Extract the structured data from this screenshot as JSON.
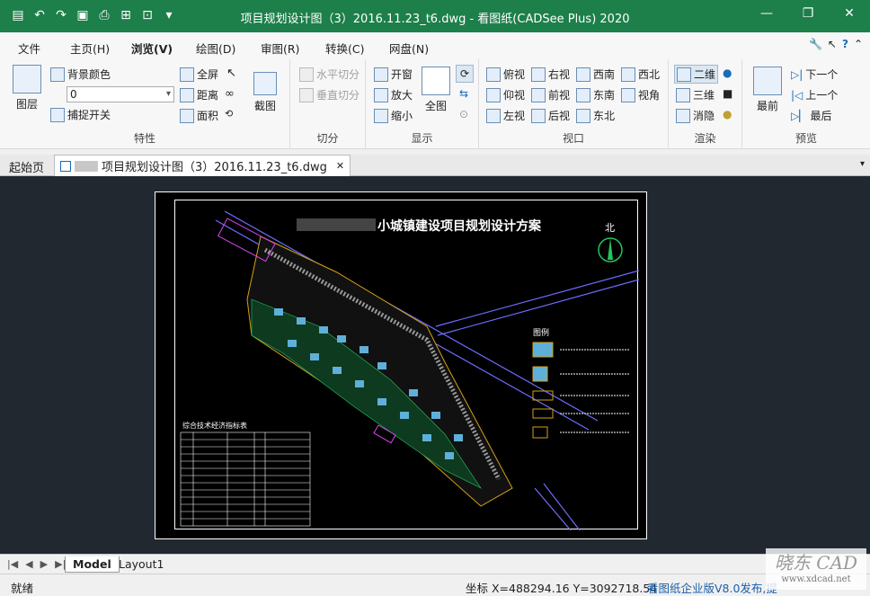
{
  "window": {
    "title": "项目规划设计图（3）2016.11.23_t6.dwg - 看图纸(CADSee Plus) 2020"
  },
  "menu": {
    "items": [
      {
        "label": "文件"
      },
      {
        "label": "主页(H)"
      },
      {
        "label": "浏览(V)"
      },
      {
        "label": "绘图(D)"
      },
      {
        "label": "审图(R)"
      },
      {
        "label": "转换(C)"
      },
      {
        "label": "网盘(N)"
      }
    ],
    "active": "浏览(V)"
  },
  "ribbon": {
    "features": {
      "label": "特性",
      "layer": "图层",
      "bg_color": "背景颜色",
      "layer_value": "0",
      "snap": "捕捉开关",
      "fullscreen": "全屏",
      "distance": "距离",
      "area": "面积",
      "screenshot": "截图"
    },
    "split": {
      "label": "切分",
      "horizontal": "水平切分",
      "vertical": "垂直切分"
    },
    "display": {
      "label": "显示",
      "open_window": "开窗",
      "zoom_in": "放大",
      "zoom_out": "缩小",
      "full_view": "全图"
    },
    "viewport": {
      "label": "视口",
      "top": "俯视",
      "right": "右视",
      "southwest": "西南",
      "northwest": "西北",
      "bottom": "仰视",
      "front": "前视",
      "southeast": "东南",
      "perspective": "视角",
      "left": "左视",
      "back": "后视",
      "northeast": "东北"
    },
    "render": {
      "label": "渲染",
      "two_d": "二维",
      "three_d": "三维",
      "hide": "消隐"
    },
    "preview": {
      "label": "预览",
      "foremost": "最前",
      "next": "下一个",
      "prev": "上一个",
      "last": "最后"
    }
  },
  "tabs": {
    "start": "起始页",
    "document": "项目规划设计图（3）2016.11.23_t6.dwg"
  },
  "drawing": {
    "title": "小城镇建设项目规划设计方案",
    "north": "北",
    "legend_title": "图例",
    "table_title": "综合技术经济指标表"
  },
  "layouts": {
    "model": "Model",
    "layout1": "Layout1"
  },
  "status": {
    "ready": "就绪",
    "coords": "坐标 X=488294.16 Y=3092718.54",
    "link": "看图纸企业版V8.0发布,提"
  },
  "watermark": {
    "brand": "晓东 CAD",
    "url": "www.xdcad.net"
  },
  "colors": {
    "title_bar": "#1d7f4a",
    "canvas_bg": "#212830",
    "sheet_bg": "#000000"
  }
}
